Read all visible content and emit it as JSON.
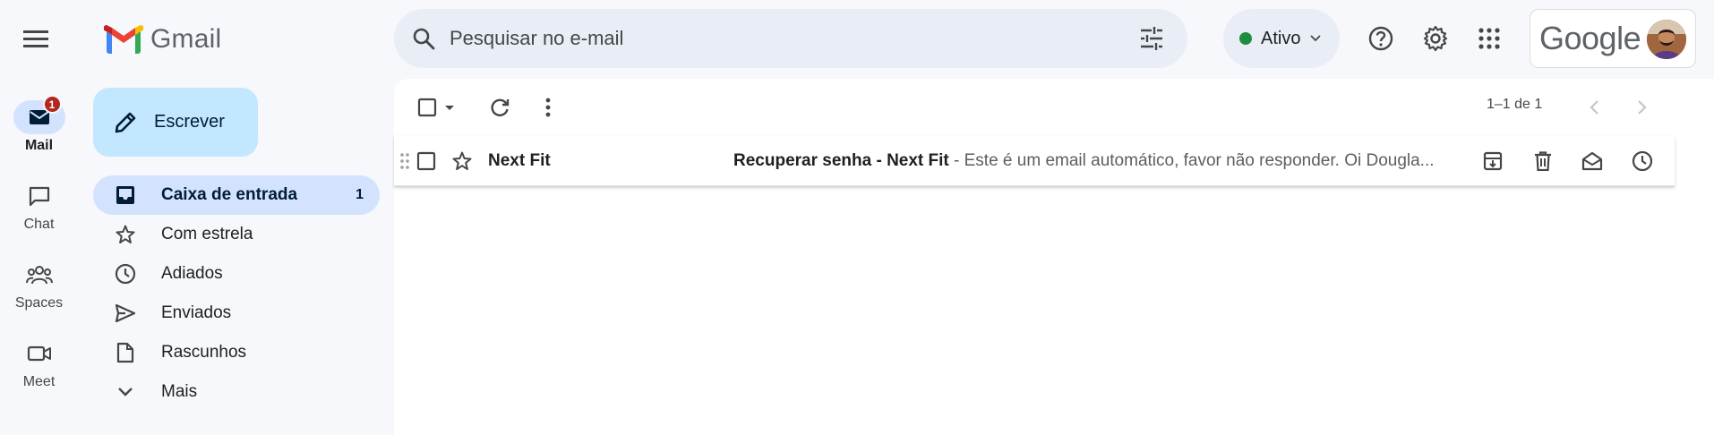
{
  "app": {
    "name": "Gmail"
  },
  "rail": {
    "items": [
      {
        "label": "Mail",
        "badge": "1",
        "active": true
      },
      {
        "label": "Chat"
      },
      {
        "label": "Spaces"
      },
      {
        "label": "Meet"
      }
    ]
  },
  "search": {
    "placeholder": "Pesquisar no e-mail"
  },
  "status": {
    "label": "Ativo",
    "color": "#1e8e3e"
  },
  "account": {
    "brand": "Google"
  },
  "compose": {
    "label": "Escrever"
  },
  "nav": {
    "items": [
      {
        "label": "Caixa de entrada",
        "count": "1",
        "icon": "inbox-icon",
        "active": true
      },
      {
        "label": "Com estrela",
        "icon": "star-icon"
      },
      {
        "label": "Adiados",
        "icon": "clock-icon"
      },
      {
        "label": "Enviados",
        "icon": "send-icon"
      },
      {
        "label": "Rascunhos",
        "icon": "draft-icon"
      },
      {
        "label": "Mais",
        "icon": "chevron-down-icon"
      }
    ]
  },
  "toolbar": {
    "pager": "1–1 de 1"
  },
  "emails": [
    {
      "sender": "Next Fit",
      "subject": "Recuperar senha - Next Fit",
      "snippet": " - Este é um email automático, favor não responder. Oi Dougla..."
    }
  ],
  "colors": {
    "accent": "#0b57d0",
    "compose_bg": "#c2e7ff",
    "nav_active_bg": "#d3e3fd",
    "badge": "#b3261e"
  }
}
